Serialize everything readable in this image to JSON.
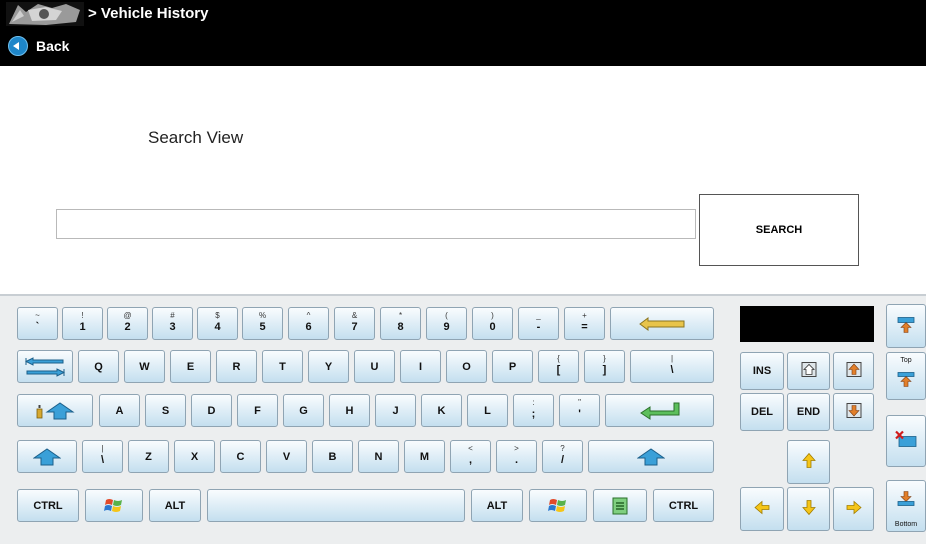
{
  "header": {
    "title": "> Vehicle History",
    "back_label": "Back"
  },
  "search": {
    "heading": "Search View",
    "input_value": "",
    "button_label": "SEARCH"
  },
  "keyboard": {
    "row1": [
      {
        "top": "~",
        "main": "`"
      },
      {
        "top": "!",
        "main": "1"
      },
      {
        "top": "@",
        "main": "2"
      },
      {
        "top": "#",
        "main": "3"
      },
      {
        "top": "$",
        "main": "4"
      },
      {
        "top": "%",
        "main": "5"
      },
      {
        "top": "^",
        "main": "6"
      },
      {
        "top": "&",
        "main": "7"
      },
      {
        "top": "*",
        "main": "8"
      },
      {
        "top": "(",
        "main": "9"
      },
      {
        "top": ")",
        "main": "0"
      },
      {
        "top": "_",
        "main": "-"
      },
      {
        "top": "+",
        "main": "="
      }
    ],
    "row2": [
      {
        "main": "Q"
      },
      {
        "main": "W"
      },
      {
        "main": "E"
      },
      {
        "main": "R"
      },
      {
        "main": "T"
      },
      {
        "main": "Y"
      },
      {
        "main": "U"
      },
      {
        "main": "I"
      },
      {
        "main": "O"
      },
      {
        "main": "P"
      },
      {
        "top": "{",
        "main": "["
      },
      {
        "top": "}",
        "main": "]"
      },
      {
        "top": "|",
        "main": "\\"
      }
    ],
    "row3": [
      {
        "main": "A"
      },
      {
        "main": "S"
      },
      {
        "main": "D"
      },
      {
        "main": "F"
      },
      {
        "main": "G"
      },
      {
        "main": "H"
      },
      {
        "main": "J"
      },
      {
        "main": "K"
      },
      {
        "main": "L"
      },
      {
        "top": ":",
        "main": ";"
      },
      {
        "top": "\"",
        "main": "'"
      }
    ],
    "row4": [
      {
        "top": "|",
        "main": "\\"
      },
      {
        "main": "Z"
      },
      {
        "main": "X"
      },
      {
        "main": "C"
      },
      {
        "main": "V"
      },
      {
        "main": "B"
      },
      {
        "main": "N"
      },
      {
        "main": "M"
      },
      {
        "top": "<",
        "main": ","
      },
      {
        "top": ">",
        "main": "."
      },
      {
        "top": "?",
        "main": "/"
      }
    ],
    "ctrl_label": "CTRL",
    "alt_label": "ALT"
  },
  "nav": {
    "ins_label": "INS",
    "del_label": "DEL",
    "end_label": "END",
    "top_label": "Top",
    "bottom_label": "Bottom"
  }
}
